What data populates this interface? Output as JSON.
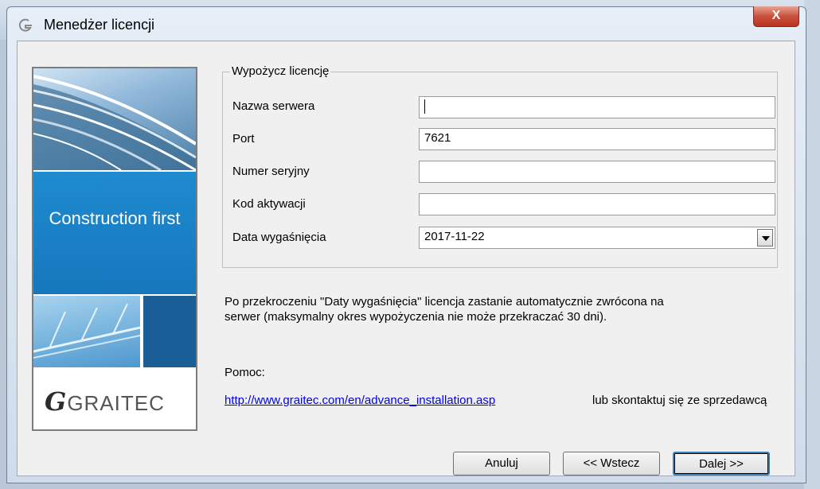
{
  "window": {
    "title": "Menedżer licencji",
    "close_label": "X"
  },
  "banner": {
    "caption": "Construction first",
    "logo_text": "GRAITEC",
    "logo_mark": "G"
  },
  "group": {
    "legend": "Wypożycz licencję",
    "fields": [
      {
        "label": "Nazwa serwera",
        "value": ""
      },
      {
        "label": "Port",
        "value": "7621"
      },
      {
        "label": "Numer seryjny",
        "value": ""
      },
      {
        "label": "Kod aktywacji",
        "value": ""
      },
      {
        "label": "Data wygaśnięcia",
        "value": "2017-11-22"
      }
    ]
  },
  "note": {
    "line1": "Po przekroczeniu \"Daty wygaśnięcia\" licencja zastanie automatycznie zwrócona na",
    "line2": "serwer (maksymalny okres wypożyczenia nie może przekraczać 30 dni)."
  },
  "help": {
    "label": "Pomoc:",
    "link": "http://www.graitec.com/en/advance_installation.asp",
    "rest": "lub skontaktuj się ze sprzedawcą"
  },
  "buttons": {
    "cancel": "Anuluj",
    "back": "<< Wstecz",
    "next": "Dalej >>"
  }
}
